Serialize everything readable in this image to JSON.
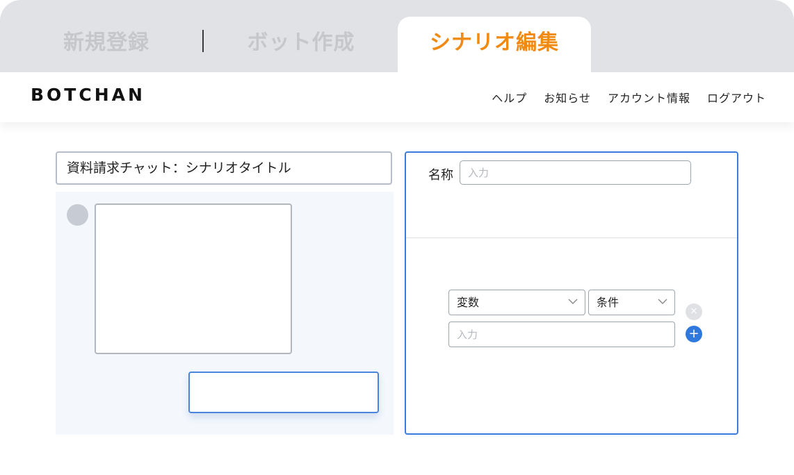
{
  "tabs": [
    {
      "label": "新規登録",
      "active": false
    },
    {
      "label": "ボット作成",
      "active": false
    },
    {
      "label": "シナリオ編集",
      "active": true
    }
  ],
  "header": {
    "logo": "BOTCHAN",
    "nav": [
      "ヘルプ",
      "お知らせ",
      "アカウント情報",
      "ログアウト"
    ]
  },
  "editor": {
    "scenario_title": "資料請求チャット：シナリオタイトル"
  },
  "settings": {
    "name_label": "名称",
    "name_placeholder": "入力",
    "variable_select": "変数",
    "condition_select": "条件",
    "condition_placeholder": "入力",
    "remove_icon": "×",
    "add_icon": "+"
  },
  "colors": {
    "accent_orange": "#f08a12",
    "accent_blue": "#2f78dd",
    "tabbar_bg": "#e1e2e6"
  }
}
